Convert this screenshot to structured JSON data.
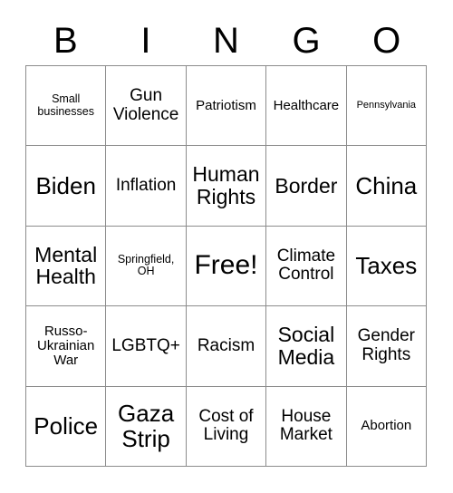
{
  "header": {
    "letters": [
      "B",
      "I",
      "N",
      "G",
      "O"
    ]
  },
  "colors": {
    "background": "#ffffff",
    "text": "#000000",
    "grid_line": "#8c8c8c"
  },
  "grid": {
    "columns": 5,
    "rows": 5,
    "free_space": "Free!",
    "cells": [
      {
        "label": "Small businesses",
        "size": "xs"
      },
      {
        "label": "Gun Violence",
        "size": "md"
      },
      {
        "label": "Patriotism",
        "size": "sm"
      },
      {
        "label": "Healthcare",
        "size": "sm"
      },
      {
        "label": "Pennsylvania",
        "size": "xxs"
      },
      {
        "label": "Biden",
        "size": "xl"
      },
      {
        "label": "Inflation",
        "size": "md"
      },
      {
        "label": "Human Rights",
        "size": "lg"
      },
      {
        "label": "Border",
        "size": "lg"
      },
      {
        "label": "China",
        "size": "xl"
      },
      {
        "label": "Mental Health",
        "size": "lg"
      },
      {
        "label": "Springfield, OH",
        "size": "xs"
      },
      {
        "label": "Free!",
        "size": "xxl"
      },
      {
        "label": "Climate Control",
        "size": "md"
      },
      {
        "label": "Taxes",
        "size": "xl"
      },
      {
        "label": "Russo-Ukrainian War",
        "size": "sm"
      },
      {
        "label": "LGBTQ+",
        "size": "md"
      },
      {
        "label": "Racism",
        "size": "md"
      },
      {
        "label": "Social Media",
        "size": "lg"
      },
      {
        "label": "Gender Rights",
        "size": "md"
      },
      {
        "label": "Police",
        "size": "xl"
      },
      {
        "label": "Gaza Strip",
        "size": "xl"
      },
      {
        "label": "Cost of Living",
        "size": "md"
      },
      {
        "label": "House Market",
        "size": "md"
      },
      {
        "label": "Abortion",
        "size": "sm"
      }
    ]
  }
}
